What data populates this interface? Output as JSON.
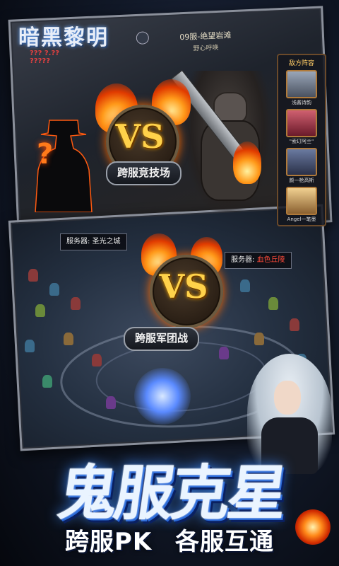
{
  "game": {
    "logo_title": "暗黑黎明",
    "logo_marks": "??? ?.??\n?????"
  },
  "top_panel": {
    "server_title": "09服-绝望岩滩",
    "server_subtitle": "野心呼唤",
    "mystery_mark": "?",
    "mode_label": "跨服竞技场",
    "vs_text": "VS",
    "enemy_list": {
      "header": "敌方阵容",
      "members": [
        {
          "name": "浅酱诗韵",
          "color": "#7a8aa0"
        },
        {
          "name": "\"索玎阿兰\"",
          "color": "#a03a4a"
        },
        {
          "name": "颜一枪高斯",
          "color": "#4a5a7a"
        },
        {
          "name": "Angel一笔墨",
          "color": "#c0a070"
        }
      ]
    }
  },
  "bottom_panel": {
    "server_a_label": "服务器:",
    "server_a_name": "圣光之城",
    "server_b_label": "服务器:",
    "server_b_name": "血色丘陵",
    "vs_text": "VS",
    "mode_label": "跨服军团战"
  },
  "banner": {
    "headline": "鬼服克星",
    "tagline_1": "跨服PK",
    "tagline_2": "各服互通"
  },
  "colors": {
    "accent_gold": "#ffd24a",
    "fire": "#ff6a00",
    "headline_blue": "#2a6ad8",
    "enemy_server_red": "#ff4a3a"
  }
}
